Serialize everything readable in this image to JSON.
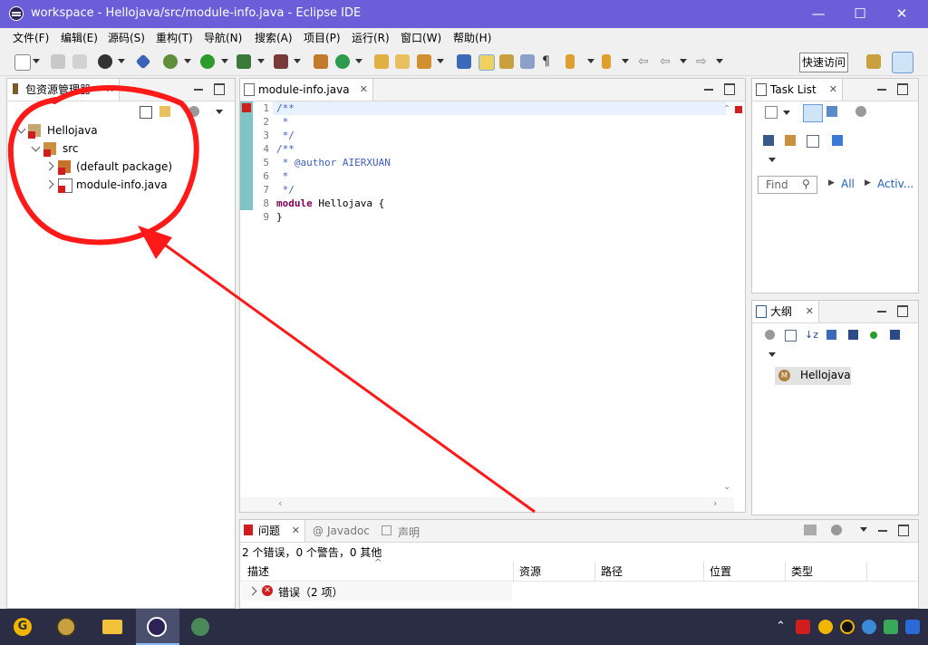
{
  "window": {
    "title": "workspace - Hellojava/src/module-info.java - Eclipse IDE",
    "minimize": "—",
    "maximize": "☐",
    "close": "✕"
  },
  "menu": [
    "文件(F)",
    "编辑(E)",
    "源码(S)",
    "重构(T)",
    "导航(N)",
    "搜索(A)",
    "项目(P)",
    "运行(R)",
    "窗口(W)",
    "帮助(H)"
  ],
  "toolbar": {
    "quick_access": "快速访问"
  },
  "package_explorer": {
    "tab_label": "包资源管理器",
    "tree": {
      "project": "Hellojava",
      "src": "src",
      "default_package": "(default package)",
      "module_file": "module-info.java"
    }
  },
  "editor": {
    "tab_label": "module-info.java",
    "lines": [
      {
        "n": "1",
        "text": "/**",
        "cls": "cmt"
      },
      {
        "n": "2",
        "text": " *",
        "cls": "cmt"
      },
      {
        "n": "3",
        "text": " */",
        "cls": "cmt"
      },
      {
        "n": "4",
        "text": "/**",
        "cls": "cmt"
      },
      {
        "n": "5",
        "text": " * @author AIERXUAN",
        "cls": "cmt"
      },
      {
        "n": "6",
        "text": " *",
        "cls": "cmt"
      },
      {
        "n": "7",
        "text": " */",
        "cls": "cmt"
      },
      {
        "n": "8",
        "kw": "module",
        "text": " Hellojava {"
      },
      {
        "n": "9",
        "text": "}"
      }
    ]
  },
  "task_list": {
    "tab_label": "Task List",
    "find_placeholder": "Find",
    "all": "All",
    "activate": "Activ..."
  },
  "outline": {
    "tab_label": "大纲",
    "item": "Hellojava"
  },
  "problems": {
    "tabs": [
      "问题",
      "Javadoc",
      "声明"
    ],
    "summary": "2 个错误，0 个警告，0 其他",
    "columns": [
      "描述",
      "资源",
      "路径",
      "位置",
      "类型"
    ],
    "row": "错误（2 项）"
  },
  "colors": {
    "titlebar": "#6b5fd9",
    "taskbar": "#2a2d43",
    "annotation": "#ff1a1a",
    "comment": "#3f5fbf",
    "keyword": "#7f0055"
  }
}
